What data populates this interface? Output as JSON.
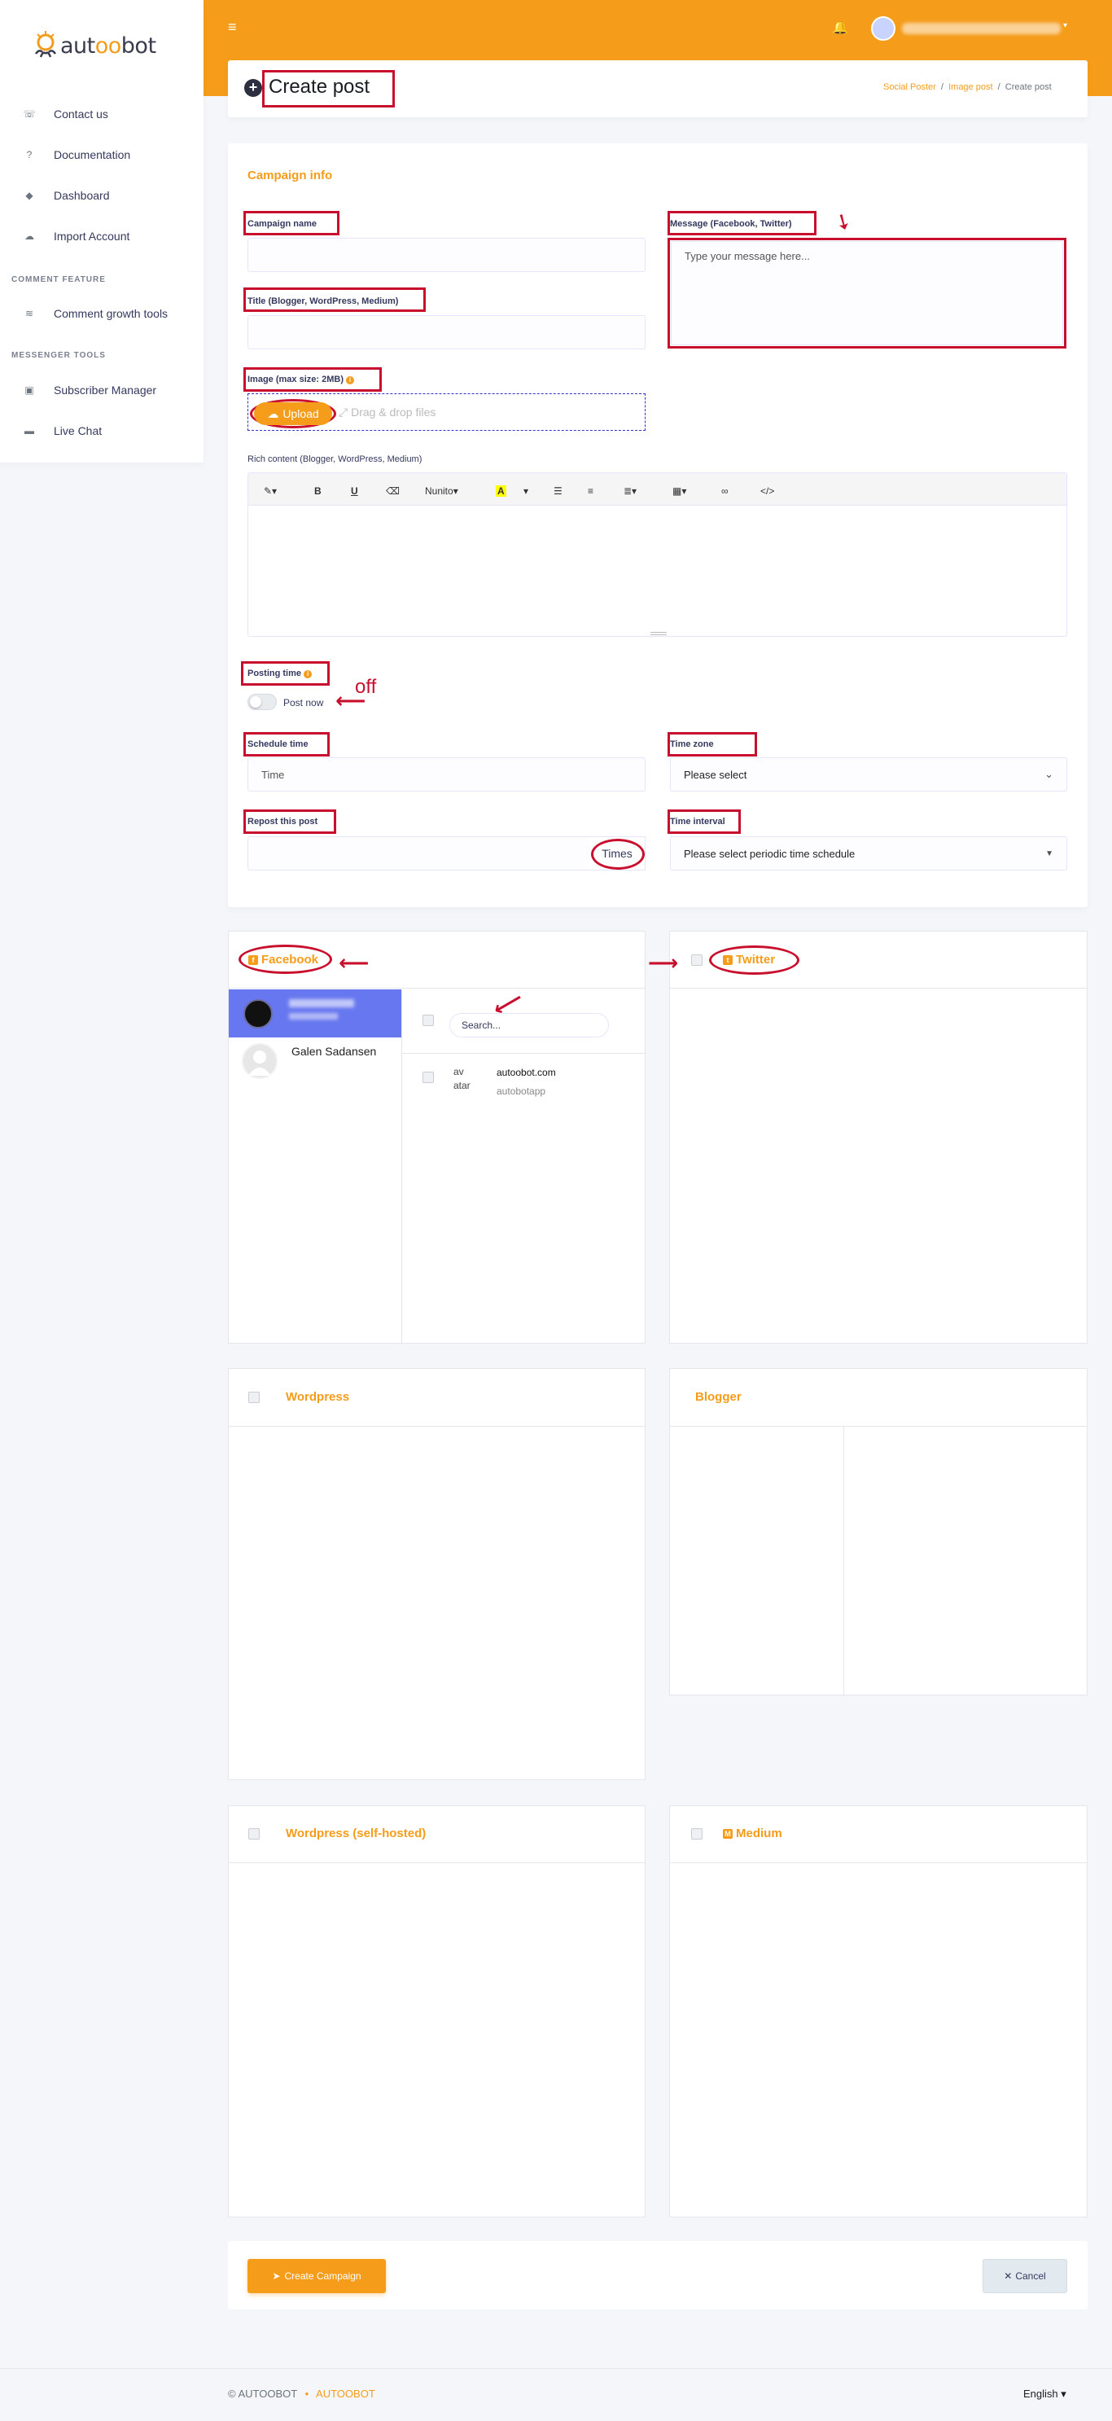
{
  "brand": {
    "logo_word_a": "aut",
    "logo_word_oo": "oo",
    "logo_word_b": "bot"
  },
  "topbar": {
    "hamburger": "≡",
    "bell": "🔔",
    "user_caret": "▾"
  },
  "sidebar": {
    "items": [
      {
        "label": "Contact us",
        "icon": "☏"
      },
      {
        "label": "Documentation",
        "icon": "?"
      },
      {
        "label": "Dashboard",
        "icon": "◆"
      },
      {
        "label": "Import Account",
        "icon": "☁"
      }
    ],
    "sections": [
      {
        "heading": "COMMENT FEATURE",
        "items": [
          {
            "label": "Comment growth tools",
            "icon": "≋"
          }
        ]
      },
      {
        "heading": "MESSENGER TOOLS",
        "items": [
          {
            "label": "Subscriber Manager",
            "icon": "▣"
          },
          {
            "label": "Live Chat",
            "icon": "▬"
          }
        ]
      }
    ]
  },
  "header": {
    "title": "Create post",
    "breadcrumb": [
      "Social Poster",
      "Image post",
      "Create post"
    ]
  },
  "campaign": {
    "section_title": "Campaign info",
    "campaign_name_label": "Campaign name",
    "title_label": "Title (Blogger, WordPress, Medium)",
    "message_label": "Message (Facebook, Twitter)",
    "message_placeholder": "Type your message here...",
    "image_label": "Image (max size: 2MB)",
    "upload_label": "Upload",
    "dragdrop_label": "Drag & drop files",
    "rich_content_label": "Rich content (Blogger, WordPress, Medium)",
    "editor_font": "Nunito",
    "posting_time_label": "Posting time",
    "post_now_label": "Post now",
    "off_annotation": "off",
    "schedule_time_label": "Schedule time",
    "schedule_time_placeholder": "Time",
    "time_zone_label": "Time zone",
    "time_zone_value": "Please select",
    "repost_label": "Repost this post",
    "times_addon": "Times",
    "time_interval_label": "Time interval",
    "time_interval_value": "Please select periodic time schedule"
  },
  "facebook": {
    "title": "Facebook",
    "user_name": "Galen Sadansen",
    "search_placeholder": "Search...",
    "account_img_alt": "av atar",
    "account_name": "autoobot.com",
    "account_sub": "autobotapp"
  },
  "twitter": {
    "title": "Twitter"
  },
  "wordpress": {
    "title": "Wordpress"
  },
  "blogger": {
    "title": "Blogger"
  },
  "wordpress_self": {
    "title": "Wordpress (self-hosted)"
  },
  "medium": {
    "title": "Medium"
  },
  "actions": {
    "create_label": "Create Campaign",
    "cancel_label": "Cancel"
  },
  "footer": {
    "copyright": "© AUTOOBOT",
    "brand": "AUTOOBOT",
    "language": "English"
  },
  "colors": {
    "accent": "#f59c1a",
    "annotation": "#c8102e",
    "active": "#6777ef"
  }
}
